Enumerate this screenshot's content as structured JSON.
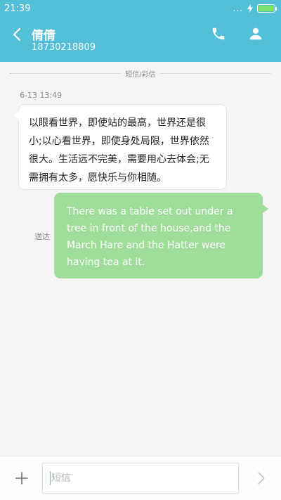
{
  "status_bar": {
    "time": "21:39",
    "signal_dots": "..."
  },
  "header": {
    "contact_name": "倩倩",
    "contact_number": "18730218809"
  },
  "thread": {
    "type_label": "短信/彩信",
    "timestamp": "6-13 13:49",
    "messages": [
      {
        "direction": "incoming",
        "text": "以眼看世界，即使站的最高，世界还是很小;以心看世界，即使身处局限，世界依然很大。生活远不完美，需要用心去体会;无需拥有太多，愿快乐与你相随。"
      },
      {
        "direction": "outgoing",
        "text": "There was a table set out under a tree in front of the house,and the March Hare and the Hatter were having tea at it.",
        "status": "送达"
      }
    ]
  },
  "composer": {
    "placeholder": "短信",
    "value": ""
  },
  "colors": {
    "accent": "#53c0d8",
    "outgoing_bubble": "#9fde9a",
    "battery": "#7be26d"
  },
  "icons": {
    "back": "back-arrow-icon",
    "phone": "phone-icon",
    "contact": "person-icon",
    "add": "plus-icon",
    "send": "send-chevron-icon",
    "battery": "battery-icon",
    "charging": "charging-bolt-icon"
  }
}
